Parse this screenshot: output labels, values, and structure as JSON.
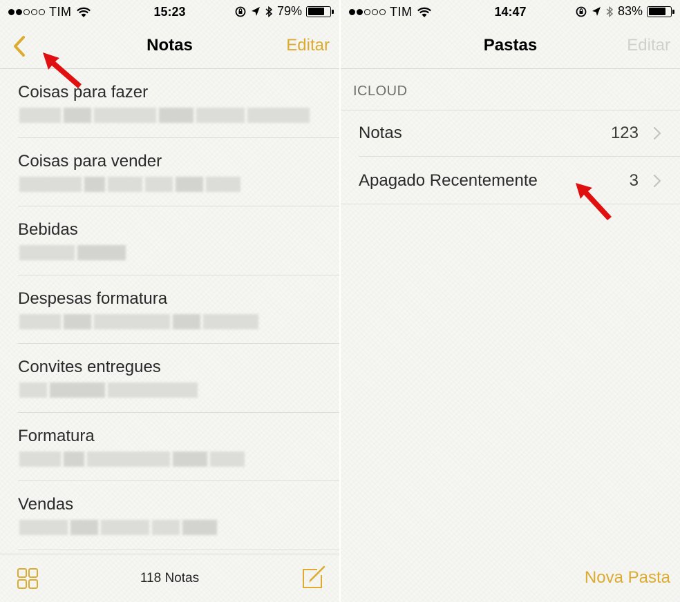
{
  "left": {
    "status": {
      "carrier": "TIM",
      "time": "15:23",
      "battery": "79%",
      "battery_level": 0.79
    },
    "nav": {
      "title": "Notas",
      "right": "Editar",
      "back_icon": "chevron-left-icon"
    },
    "notes": [
      {
        "title": "Coisas para fazer"
      },
      {
        "title": "Coisas para vender"
      },
      {
        "title": "Bebidas"
      },
      {
        "title": "Despesas formatura"
      },
      {
        "title": "Convites entregues"
      },
      {
        "title": "Formatura"
      },
      {
        "title": "Vendas"
      }
    ],
    "toolbar": {
      "count": "118 Notas",
      "left_icon": "grid-icon",
      "right_icon": "compose-icon"
    }
  },
  "right": {
    "status": {
      "carrier": "TIM",
      "time": "14:47",
      "battery": "83%",
      "battery_level": 0.83
    },
    "nav": {
      "title": "Pastas",
      "right": "Editar"
    },
    "section": "ICLOUD",
    "folders": [
      {
        "name": "Notas",
        "count": "123"
      },
      {
        "name": "Apagado Recentemente",
        "count": "3"
      }
    ],
    "toolbar": {
      "right": "Nova Pasta"
    }
  },
  "annotations": {
    "arrow_color": "#e01010"
  },
  "colors": {
    "accent": "#dcab30",
    "background": "#f6f6f3"
  }
}
